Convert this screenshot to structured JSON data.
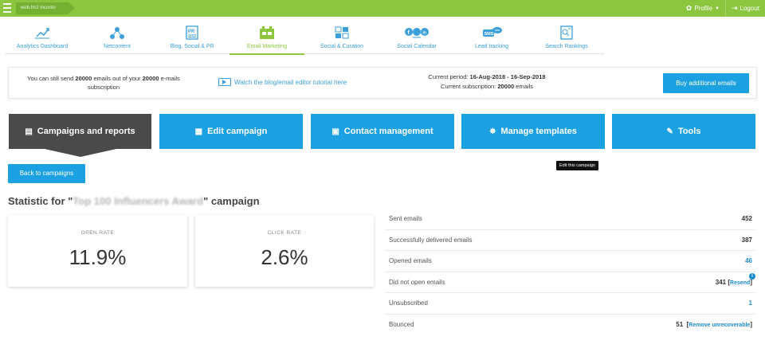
{
  "topbar": {
    "breadcrumb": "web.fm2 inconto",
    "profile_label": "Profile",
    "logout_label": "Logout",
    "color": "#8cc63e"
  },
  "nav": [
    {
      "label": "Analytics Dashboard",
      "icon": "analytics-icon"
    },
    {
      "label": "Netcontent",
      "icon": "network-icon"
    },
    {
      "label": "Blog, Social & PR",
      "icon": "pr-document-icon"
    },
    {
      "label": "Email Marketing",
      "icon": "email-icon",
      "active": true
    },
    {
      "label": "Social & Curation",
      "icon": "curation-icon"
    },
    {
      "label": "Social Calendar",
      "icon": "social-networks-icon"
    },
    {
      "label": "Lead tracking",
      "icon": "sms-icon"
    },
    {
      "label": "Search Rankings",
      "icon": "search-rankings-icon"
    }
  ],
  "banner": {
    "send_prefix": "You can still send ",
    "send_count": "20000",
    "send_middle": " emails out of your ",
    "send_total": "20000",
    "send_suffix": " e-mails subscription",
    "video_link": "Watch the blog/email editor tutorial here",
    "period_label": "Current period: ",
    "period_value": "16-Aug-2018 - 16-Sep-2018",
    "subscription_label": "Current subscription: ",
    "subscription_value": "20000",
    "subscription_suffix": " emails",
    "buy_label": "Buy additional emails"
  },
  "actions": [
    {
      "label": "Campaigns and reports",
      "icon": "campaigns-icon",
      "active": true
    },
    {
      "label": "Edit campaign",
      "icon": "edit-campaign-icon"
    },
    {
      "label": "Contact management",
      "icon": "contacts-icon"
    },
    {
      "label": "Manage templates",
      "icon": "gear-icon"
    },
    {
      "label": "Tools",
      "icon": "wrench-icon"
    }
  ],
  "tooltip": "Edit this campaign",
  "back_label": "Back to campaigns",
  "title": {
    "prefix": "Statistic for \"",
    "campaign": "Top 100 Influencers Award",
    "suffix": "\" campaign"
  },
  "cards": [
    {
      "label": "OPEN RATE",
      "value": "11.9%"
    },
    {
      "label": "CLICK RATE",
      "value": "2.6%"
    }
  ],
  "stats": [
    {
      "label": "Sent emails",
      "value": "452"
    },
    {
      "label": "Successfully delivered emails",
      "value": "387"
    },
    {
      "label": "Opened emails",
      "value": "46"
    },
    {
      "label": "Did not open emails",
      "value": "341",
      "link": "Resend"
    },
    {
      "label": "Unsubscribed",
      "value": "1"
    },
    {
      "label": "Bounced",
      "value": "51",
      "link": "Remove unrecoverable"
    }
  ]
}
